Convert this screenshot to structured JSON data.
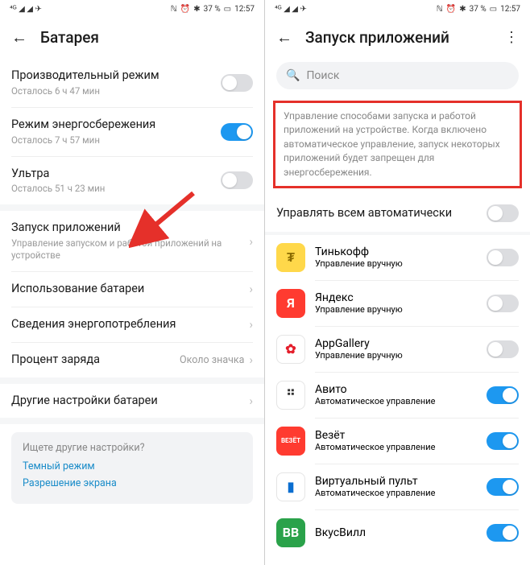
{
  "status": {
    "signal": "⁴ᴳ ◢ ◢ ✈",
    "nfc": "ℕ",
    "alarm": "⏰",
    "bt": "✱",
    "battery_pct": "37 %",
    "battery_icon": "▭",
    "time": "12:57"
  },
  "left": {
    "title": "Батарея",
    "rows": {
      "perf": {
        "title": "Производительный режим",
        "sub": "Осталось 6 ч 47 мин"
      },
      "save": {
        "title": "Режим энергосбережения",
        "sub": "Осталось 7 ч 57 мин"
      },
      "ultra": {
        "title": "Ультра",
        "sub": "Осталось 51 ч 23 мин"
      },
      "launch": {
        "title": "Запуск приложений",
        "sub": "Управление запуском и работой приложений на устройстве"
      },
      "usage": {
        "title": "Использование батареи"
      },
      "details": {
        "title": "Сведения энергопотребления"
      },
      "percent": {
        "title": "Процент заряда",
        "value": "Около значка"
      },
      "other": {
        "title": "Другие настройки батареи"
      }
    },
    "tip": {
      "q": "Ищете другие настройки?",
      "link1": "Темный режим",
      "link2": "Разрешение экрана"
    }
  },
  "right": {
    "title": "Запуск приложений",
    "search_placeholder": "Поиск",
    "info": "Управление способами запуска и работой приложений на устройстве. Когда включено автоматическое управление, запуск некоторых приложений будет запрещен для энергосбережения.",
    "manage_all": "Управлять всем автоматически",
    "sub_manual": "Управление вручную",
    "sub_auto": "Автоматическое управление",
    "apps": [
      {
        "name": "Тинькофф",
        "sub": "Управление вручную",
        "toggle": false,
        "bg": "#ffd84a",
        "fg": "#8a6b00",
        "label": "₮"
      },
      {
        "name": "Яндекс",
        "sub": "Управление вручную",
        "toggle": false,
        "bg": "#ff3b30",
        "fg": "#fff",
        "label": "Я"
      },
      {
        "name": "AppGallery",
        "sub": "Управление вручную",
        "toggle": false,
        "bg": "#ffffff",
        "fg": "#e41e2b",
        "label": "✿"
      },
      {
        "name": "Авито",
        "sub": "Автоматическое управление",
        "toggle": true,
        "bg": "#ffffff",
        "fg": "#333",
        "label": "⠛"
      },
      {
        "name": "Везёт",
        "sub": "Автоматическое управление",
        "toggle": true,
        "bg": "#ff3b30",
        "fg": "#fff",
        "label": "ВЕЗЁТ"
      },
      {
        "name": "Виртуальный пульт",
        "sub": "Автоматическое управление",
        "toggle": true,
        "bg": "#ffffff",
        "fg": "#0b6ed0",
        "label": "▮"
      },
      {
        "name": "ВкусВилл",
        "sub": "",
        "toggle": true,
        "bg": "#2aa24a",
        "fg": "#fff",
        "label": "ВВ"
      }
    ]
  }
}
